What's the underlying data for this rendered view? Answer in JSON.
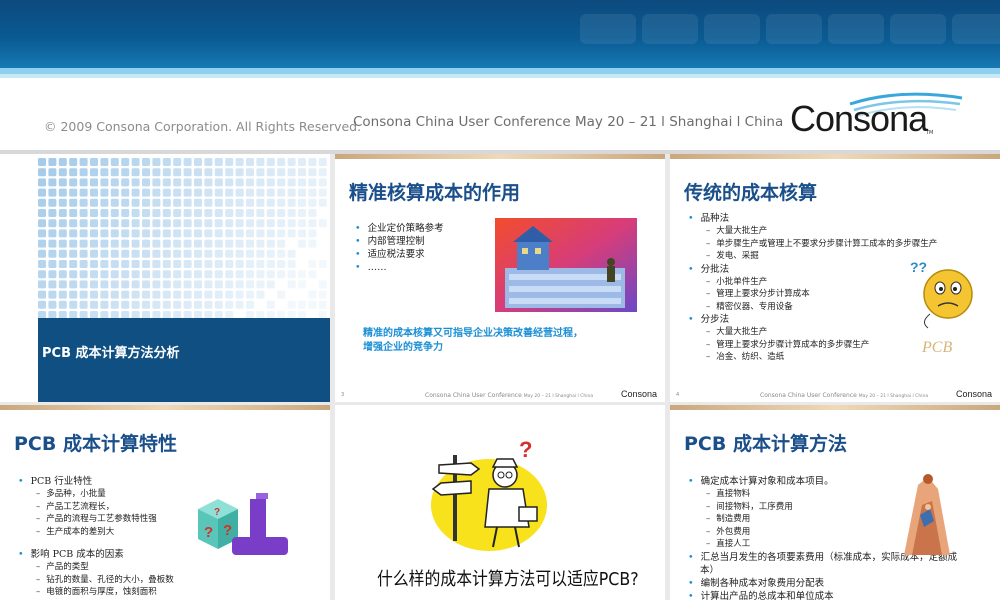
{
  "header": {
    "copyright": "© 2009 Consona Corporation. All Rights Reserved.",
    "conference": "Consona China User Conference  May 20 – 21 l Shanghai l China",
    "logo": "Consona",
    "logo_tm": "TM"
  },
  "slides": {
    "s1": {
      "title": "PCB 成本计算方法分析"
    },
    "s2": {
      "title": "精准核算成本的作用",
      "bullets": [
        "企业定价策略参考",
        "内部管理控制",
        "适应税法要求",
        "……"
      ],
      "highlight_line1": "精准的成本核算又可指导企业决策改善经营过程，",
      "highlight_line2": "增强企业的竞争力",
      "page": "3",
      "footer": "Consona China User Conference",
      "footer_small": "May 20 – 21 l Shanghai l China",
      "logo": "Consona"
    },
    "s3": {
      "title": "传统的成本核算",
      "items": [
        {
          "level": 1,
          "text": "品种法"
        },
        {
          "level": 2,
          "text": "大量大批生产"
        },
        {
          "level": 2,
          "text": "单步骤生产或管理上不要求分步骤计算工成本的多步骤生产"
        },
        {
          "level": 2,
          "text": "发电、采掘"
        },
        {
          "level": 1,
          "text": "分批法"
        },
        {
          "level": 2,
          "text": "小批单件生产"
        },
        {
          "level": 2,
          "text": "管理上要求分步计算成本"
        },
        {
          "level": 2,
          "text": "精密仪器、专用设备"
        },
        {
          "level": 1,
          "text": "分步法"
        },
        {
          "level": 2,
          "text": "大量大批生产"
        },
        {
          "level": 2,
          "text": "管理上要求分步骤计算成本的多步骤生产"
        },
        {
          "level": 2,
          "text": "冶金、纺织、造纸"
        }
      ],
      "image_text": "PCB",
      "page": "4",
      "footer": "Consona China User Conference",
      "footer_small": "May 20 – 21 l Shanghai l China",
      "logo": "Consona"
    },
    "s4": {
      "title": "PCB 成本计算特性",
      "items": [
        {
          "level": 1,
          "text": "PCB 行业特性"
        },
        {
          "level": 2,
          "text": "多品种，小批量"
        },
        {
          "level": 2,
          "text": "产品工艺流程长，"
        },
        {
          "level": 2,
          "text": "产品的流程与工艺参数特性强"
        },
        {
          "level": 2,
          "text": "生产成本的差别大"
        },
        {
          "level": 0,
          "text": ""
        },
        {
          "level": 1,
          "text": "影响 PCB 成本的因素"
        },
        {
          "level": 2,
          "text": "产品的类型"
        },
        {
          "level": 2,
          "text": "钻孔的数量、孔径的大小，叠板数"
        },
        {
          "level": 2,
          "text": "电镀的面积与厚度，蚀刻面积"
        }
      ]
    },
    "s5": {
      "question": "什么样的成本计算方法可以适应PCB?"
    },
    "s6": {
      "title": "PCB 成本计算方法",
      "items": [
        {
          "level": 1,
          "text": "确定成本计算对象和成本项目。"
        },
        {
          "level": 2,
          "text": "直接物料"
        },
        {
          "level": 2,
          "text": "间接物料，工序费用"
        },
        {
          "level": 2,
          "text": "制造费用"
        },
        {
          "level": 2,
          "text": "外包费用"
        },
        {
          "level": 2,
          "text": "直接人工"
        },
        {
          "level": 1,
          "text": "汇总当月发生的各项要素费用（标准成本，实际成本，定额成"
        },
        {
          "level": 3,
          "text": "本）"
        },
        {
          "level": 1,
          "text": "编制各种成本对象费用分配表"
        },
        {
          "level": 1,
          "text": "计算出产品的总成本和单位成本"
        }
      ]
    }
  },
  "colors": {
    "title": "#1b4f8a",
    "accent_blue": "#0a5a92",
    "highlight": "#1b8fd4"
  }
}
